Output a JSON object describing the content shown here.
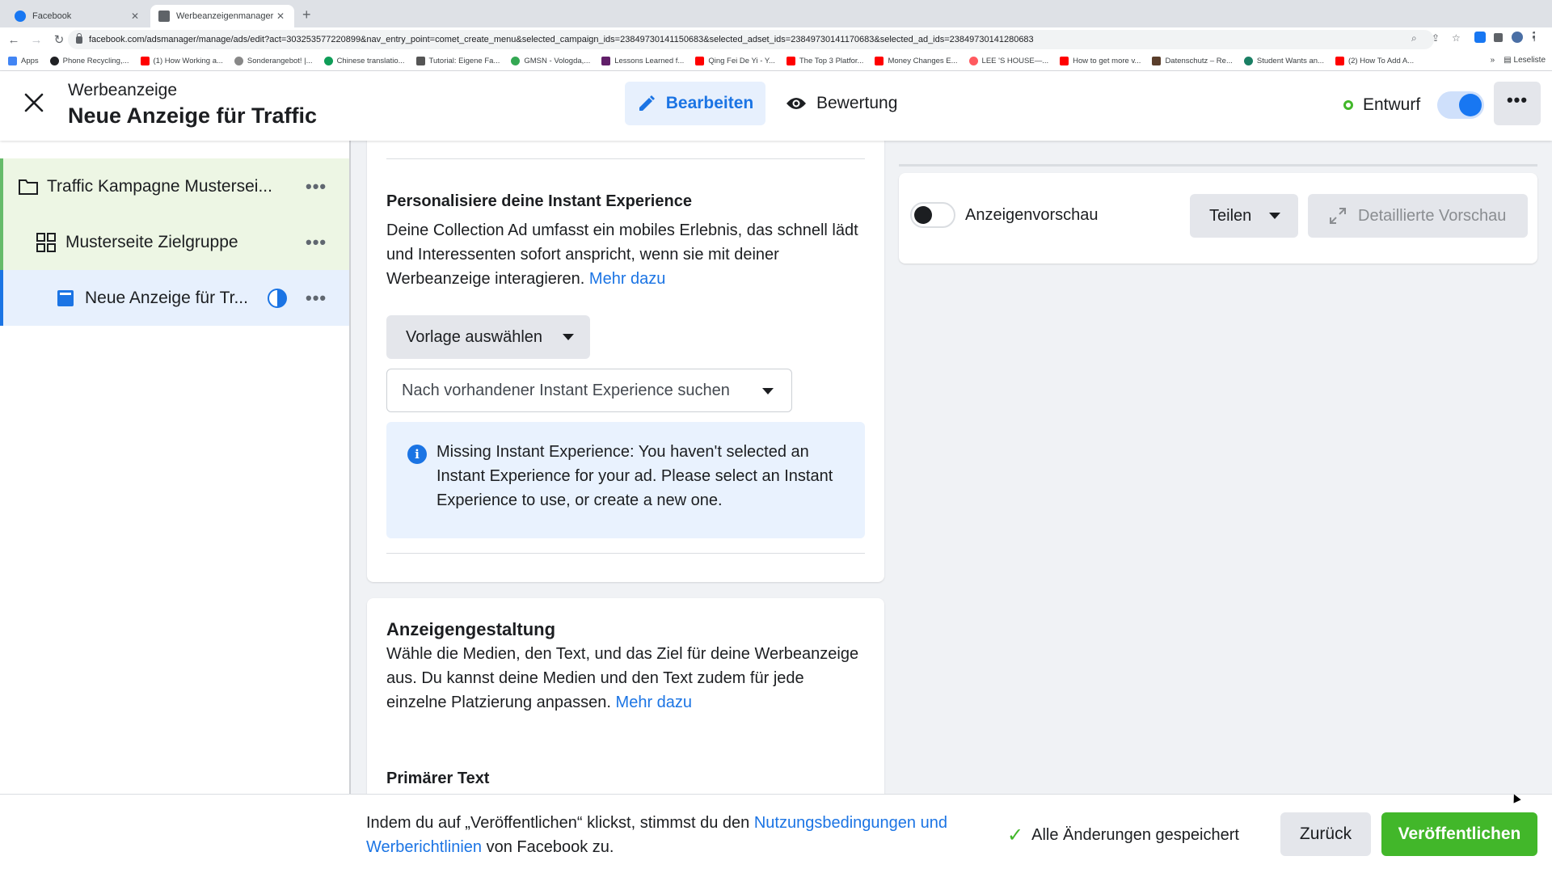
{
  "browser": {
    "tabs": [
      {
        "title": "Facebook",
        "active": false
      },
      {
        "title": "Werbeanzeigenmanager - Werb",
        "active": true
      }
    ],
    "url": "facebook.com/adsmanager/manage/ads/edit?act=303253577220899&nav_entry_point=comet_create_menu&selected_campaign_ids=23849730141150683&selected_adset_ids=23849730141170683&selected_ad_ids=23849730141280683",
    "bookmarks": [
      "Apps",
      "Phone Recycling,...",
      "(1) How Working a...",
      "Sonderangebot! |...",
      "Chinese translatio...",
      "Tutorial: Eigene Fa...",
      "GMSN - Vologda,...",
      "Lessons Learned f...",
      "Qing Fei De Yi - Y...",
      "The Top 3 Platfor...",
      "Money Changes E...",
      "LEE 'S HOUSE—...",
      "How to get more v...",
      "Datenschutz – Re...",
      "Student Wants an...",
      "(2) How To Add A..."
    ],
    "reading_list": "Leseliste"
  },
  "header": {
    "subtitle": "Werbeanzeige",
    "title": "Neue Anzeige für Traffic",
    "edit_label": "Bearbeiten",
    "review_label": "Bewertung",
    "status_label": "Entwurf",
    "toggle_on": true
  },
  "tree": {
    "campaign": "Traffic Kampagne Mustersei...",
    "adset": "Musterseite Zielgruppe",
    "ad": "Neue Anzeige für Tr..."
  },
  "instant_experience": {
    "title": "Personalisiere deine Instant Experience",
    "body": "Deine Collection Ad umfasst ein mobiles Erlebnis, das schnell lädt und Interessenten sofort anspricht, wenn sie mit deiner Werbeanzeige interagieren.",
    "more_link": "Mehr dazu",
    "template_button": "Vorlage auswählen",
    "search_placeholder": "Nach vorhandener Instant Experience suchen",
    "info_message": "Missing Instant Experience: You haven't selected an Instant Experience for your ad. Please select an Instant Experience to use, or create a new one."
  },
  "ad_design": {
    "title": "Anzeigengestaltung",
    "body": "Wähle die Medien, den Text, und das Ziel für deine Werbeanzeige aus. Du kannst deine Medien und den Text zudem für jede einzelne Platzierung anpassen.",
    "more_link": "Mehr dazu",
    "primary_text_label": "Primärer Text"
  },
  "preview": {
    "toggle_label": "Anzeigenvorschau",
    "share_label": "Teilen",
    "detail_label": "Detaillierte Vorschau"
  },
  "footer": {
    "terms_prefix": "Indem du auf „Veröffentlichen“ klickst, stimmst du den",
    "terms_link": "Nutzungsbedingungen und Werberichtlinien",
    "terms_suffix": "von Facebook zu.",
    "saved_label": "Alle Änderungen gespeichert",
    "back_label": "Zurück",
    "publish_label": "Veröffentlichen"
  },
  "colors": {
    "accent": "#1b74e4",
    "publish_green": "#42b72a",
    "tree_green_bg": "#edf6e4",
    "tree_blue_bg": "#e7f0fd"
  }
}
